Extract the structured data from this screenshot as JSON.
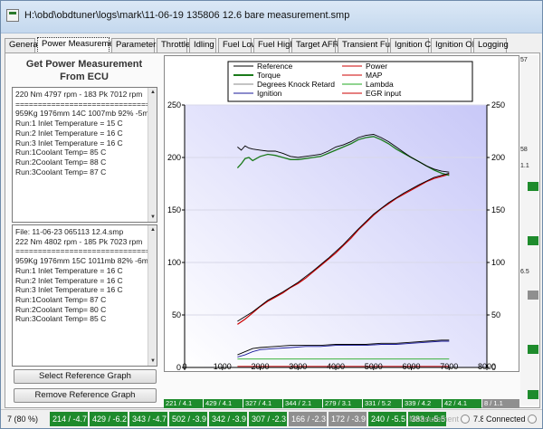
{
  "window": {
    "title": "H:\\obd\\obdtuner\\logs\\mark\\11-06-19 135806 12.6 bare measurement.smp"
  },
  "tabs": [
    {
      "label": "General",
      "active": false
    },
    {
      "label": "Power Measurements",
      "active": true
    },
    {
      "label": "Parameters",
      "active": false
    },
    {
      "label": "Throttle",
      "active": false
    },
    {
      "label": "Idling",
      "active": false
    },
    {
      "label": "Fuel Low",
      "active": false
    },
    {
      "label": "Fuel High",
      "active": false
    },
    {
      "label": "Target AFR",
      "active": false
    },
    {
      "label": "Transient Fuel",
      "active": false
    },
    {
      "label": "Ignition CL",
      "active": false
    },
    {
      "label": "Ignition OL",
      "active": false
    },
    {
      "label": "Logging",
      "active": false
    }
  ],
  "left_panel": {
    "header_line1": "Get Power Measurement",
    "header_line2": "From ECU",
    "memo_top": [
      "220 Nm 4797 rpm - 183 Pk 7012 rpm",
      "=====================================",
      "959Kg 1976mm 14C 1007mb 92% -5m",
      "Run:1 Inlet Temperature = 15 C",
      "Run:2 Inlet Temperature = 16 C",
      "Run:3 Inlet Temperature = 16 C",
      "Run:1Coolant Temp= 85 C",
      "Run:2Coolant Temp= 88 C",
      "Run:3Coolant Temp= 87 C"
    ],
    "memo_bottom": [
      "File: 11-06-23 065113 12.4.smp",
      "222 Nm 4802 rpm - 185 Pk 7023 rpm",
      "=====================================",
      "959Kg 1976mm 15C 1011mb 82% -6m",
      "Run:1 Inlet Temperature = 16 C",
      "Run:2 Inlet Temperature = 16 C",
      "Run:3 Inlet Temperature = 16 C",
      "Run:1Coolant Temp= 87 C",
      "Run:2Coolant Temp= 80 C",
      "Run:3Coolant Temp= 85 C"
    ],
    "select_button": "Select Reference Graph",
    "remove_button": "Remove Reference Graph"
  },
  "chart_data": {
    "type": "line",
    "xlim": [
      0,
      8000
    ],
    "ylim_left": [
      0,
      250
    ],
    "ylim_right": [
      0,
      250
    ],
    "x_ticks": [
      "0",
      "1000",
      "2000",
      "3000",
      "4000",
      "5000",
      "6000",
      "7000",
      "8000"
    ],
    "y_ticks": [
      "0",
      "50",
      "100",
      "150",
      "200",
      "250"
    ],
    "legend": [
      {
        "name": "Reference",
        "color": "#000000"
      },
      {
        "name": "Power",
        "color": "#cc0000"
      },
      {
        "name": "Torque",
        "color": "#1a7a1a"
      },
      {
        "name": "MAP",
        "color": "#cc0000"
      },
      {
        "name": "Degrees Knock Retard",
        "color": "#888888"
      },
      {
        "name": "Lambda",
        "color": "#22aa22"
      },
      {
        "name": "Ignition",
        "color": "#1a1a9a"
      },
      {
        "name": "EGR input",
        "color": "#cc0000"
      }
    ],
    "series": [
      {
        "name": "Power",
        "color": "#cc0000",
        "x": [
          1400,
          1600,
          1800,
          2000,
          2200,
          2400,
          2600,
          2800,
          3000,
          3200,
          3400,
          3600,
          3800,
          4000,
          4200,
          4400,
          4600,
          4800,
          5000,
          5200,
          5400,
          5600,
          5800,
          6000,
          6200,
          6400,
          6600,
          6800,
          7000
        ],
        "y": [
          41,
          46,
          52,
          58,
          63,
          67,
          71,
          76,
          80,
          85,
          91,
          97,
          103,
          109,
          116,
          123,
          131,
          138,
          145,
          151,
          156,
          161,
          165,
          169,
          173,
          177,
          180,
          182,
          184
        ]
      },
      {
        "name": "Torque",
        "color": "#1a7a1a",
        "x": [
          1400,
          1500,
          1600,
          1700,
          1800,
          2000,
          2200,
          2400,
          2600,
          2800,
          3000,
          3200,
          3400,
          3600,
          3800,
          4000,
          4200,
          4400,
          4600,
          4800,
          5000,
          5200,
          5400,
          5600,
          5800,
          6000,
          6200,
          6400,
          6600,
          6800,
          7000
        ],
        "y": [
          190,
          194,
          199,
          200,
          197,
          201,
          203,
          202,
          200,
          198,
          198,
          199,
          200,
          201,
          204,
          207,
          210,
          213,
          217,
          219,
          220,
          217,
          213,
          208,
          204,
          200,
          196,
          192,
          188,
          185,
          183
        ]
      },
      {
        "name": "Reference",
        "color": "#000000",
        "x": [
          1400,
          1500,
          1600,
          1700,
          1800,
          2000,
          2200,
          2400,
          2600,
          2800,
          3000,
          3200,
          3400,
          3600,
          3800,
          4000,
          4200,
          4400,
          4600,
          4800,
          5000,
          5200,
          5400,
          5600,
          5800,
          6000,
          6200,
          6400,
          6600,
          6800,
          7000
        ],
        "y": [
          210,
          207,
          211,
          209,
          208,
          207,
          206,
          206,
          204,
          201,
          200,
          201,
          202,
          203,
          206,
          210,
          212,
          215,
          219,
          221,
          222,
          219,
          215,
          210,
          205,
          200,
          196,
          192,
          189,
          187,
          186
        ]
      },
      {
        "name": "Reference Power",
        "color": "#000000",
        "x": [
          1400,
          1800,
          2200,
          2600,
          3000,
          3400,
          3800,
          4200,
          4600,
          5000,
          5400,
          5800,
          6200,
          6600,
          7000
        ],
        "y": [
          44,
          53,
          64,
          72,
          81,
          92,
          104,
          117,
          132,
          146,
          157,
          166,
          174,
          181,
          185
        ]
      },
      {
        "name": "Ignition",
        "color": "#1a1a9a",
        "x": [
          1400,
          1600,
          1800,
          2000,
          2400,
          2800,
          3200,
          3600,
          4000,
          4400,
          4800,
          5200,
          5600,
          6000,
          6400,
          6800,
          7000
        ],
        "y": [
          10,
          12,
          15,
          17,
          18,
          19,
          20,
          20,
          21,
          21,
          21,
          22,
          22,
          23,
          24,
          25,
          25
        ]
      },
      {
        "name": "Reference Ignition",
        "color": "#000000",
        "x": [
          1400,
          1600,
          1800,
          2000,
          2400,
          2800,
          3200,
          3600,
          4000,
          4400,
          4800,
          5200,
          5600,
          6000,
          6400,
          6800,
          7000
        ],
        "y": [
          12,
          15,
          18,
          19,
          20,
          21,
          21,
          21,
          22,
          22,
          22,
          23,
          23,
          24,
          25,
          26,
          26
        ]
      },
      {
        "name": "Lambda",
        "color": "#22aa22",
        "x": [
          1400,
          7000
        ],
        "y": [
          8,
          8
        ]
      },
      {
        "name": "MAP",
        "color": "#cc0000",
        "x": [
          1400,
          7000
        ],
        "y": [
          1,
          1
        ]
      }
    ]
  },
  "right_strip": [
    "57",
    "",
    "",
    "",
    "",
    "",
    "",
    "",
    "",
    "",
    "",
    "58",
    "",
    "1.1",
    "",
    "",
    "",
    "",
    "",
    "",
    "",
    "",
    "",
    "",
    "",
    "",
    "6.5",
    "",
    "",
    "",
    "",
    "",
    "",
    "",
    "",
    "",
    "",
    "",
    "",
    "",
    "",
    ""
  ],
  "grid_row_values": [
    {
      "text": "221 / 4.1",
      "color": "#1e8b2c"
    },
    {
      "text": "429 / 4.1",
      "color": "#1e8b2c"
    },
    {
      "text": "327 / 4.1",
      "color": "#1e8b2c"
    },
    {
      "text": "344 / 2.1",
      "color": "#1e8b2c"
    },
    {
      "text": "279 / 3.1",
      "color": "#1e8b2c"
    },
    {
      "text": "331 / 5.2",
      "color": "#1e8b2c"
    },
    {
      "text": "339 / 4.2",
      "color": "#1e8b2c"
    },
    {
      "text": "42 / 4.1",
      "color": "#1e8b2c"
    },
    {
      "text": "8 / 1.1",
      "color": "#8f8f8f"
    }
  ],
  "status_bar": {
    "cells": [
      {
        "text": "7 (80 %)",
        "style": "plain"
      },
      {
        "text": "214 / -4.7",
        "style": "green"
      },
      {
        "text": "429 / -6.2",
        "style": "green"
      },
      {
        "text": "343 / -4.7",
        "style": "green"
      },
      {
        "text": "502 / -3.9",
        "style": "green"
      },
      {
        "text": "342 / -3.9",
        "style": "green"
      },
      {
        "text": "307 / -2.3",
        "style": "green"
      },
      {
        "text": "166 / -2.3",
        "style": "gray"
      },
      {
        "text": "172 / -3.9",
        "style": "gray"
      },
      {
        "text": "240 / -5.5",
        "style": "green"
      },
      {
        "text": "383 / -5.5",
        "style": "green"
      }
    ],
    "measurement_label": "Measurement Off",
    "value": "7.8",
    "connected_label": "Connected"
  }
}
